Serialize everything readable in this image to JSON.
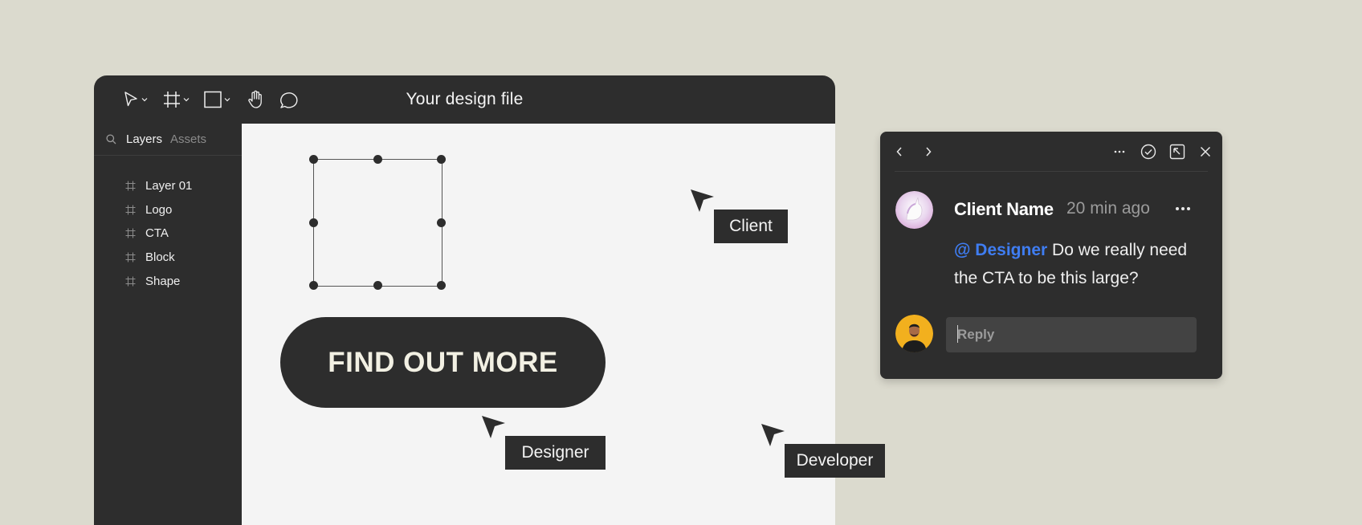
{
  "app": {
    "file_title": "Your design file",
    "tools": [
      {
        "icon": "move-pointer-icon"
      },
      {
        "icon": "frame-icon"
      },
      {
        "icon": "rectangle-icon"
      },
      {
        "icon": "hand-icon"
      },
      {
        "icon": "comment-icon"
      }
    ]
  },
  "sidebar": {
    "tab_layers": "Layers",
    "tab_assets": "Assets",
    "layers": [
      {
        "label": "Layer 01"
      },
      {
        "label": "Logo"
      },
      {
        "label": "CTA"
      },
      {
        "label": "Block"
      },
      {
        "label": "Shape"
      }
    ]
  },
  "canvas": {
    "cta_label": "FIND OUT MORE"
  },
  "cursors": {
    "client": "Client",
    "designer": "Designer",
    "developer": "Developer"
  },
  "comment": {
    "author": "Client Name",
    "time": "20 min ago",
    "mention": "@ Designer",
    "message": " Do we really need the CTA to be this large?",
    "reply_placeholder": "Reply"
  },
  "colors": {
    "background": "#dbdace",
    "dark": "#2d2d2d",
    "canvas": "#f4f4f4",
    "mention": "#3f7df2"
  }
}
